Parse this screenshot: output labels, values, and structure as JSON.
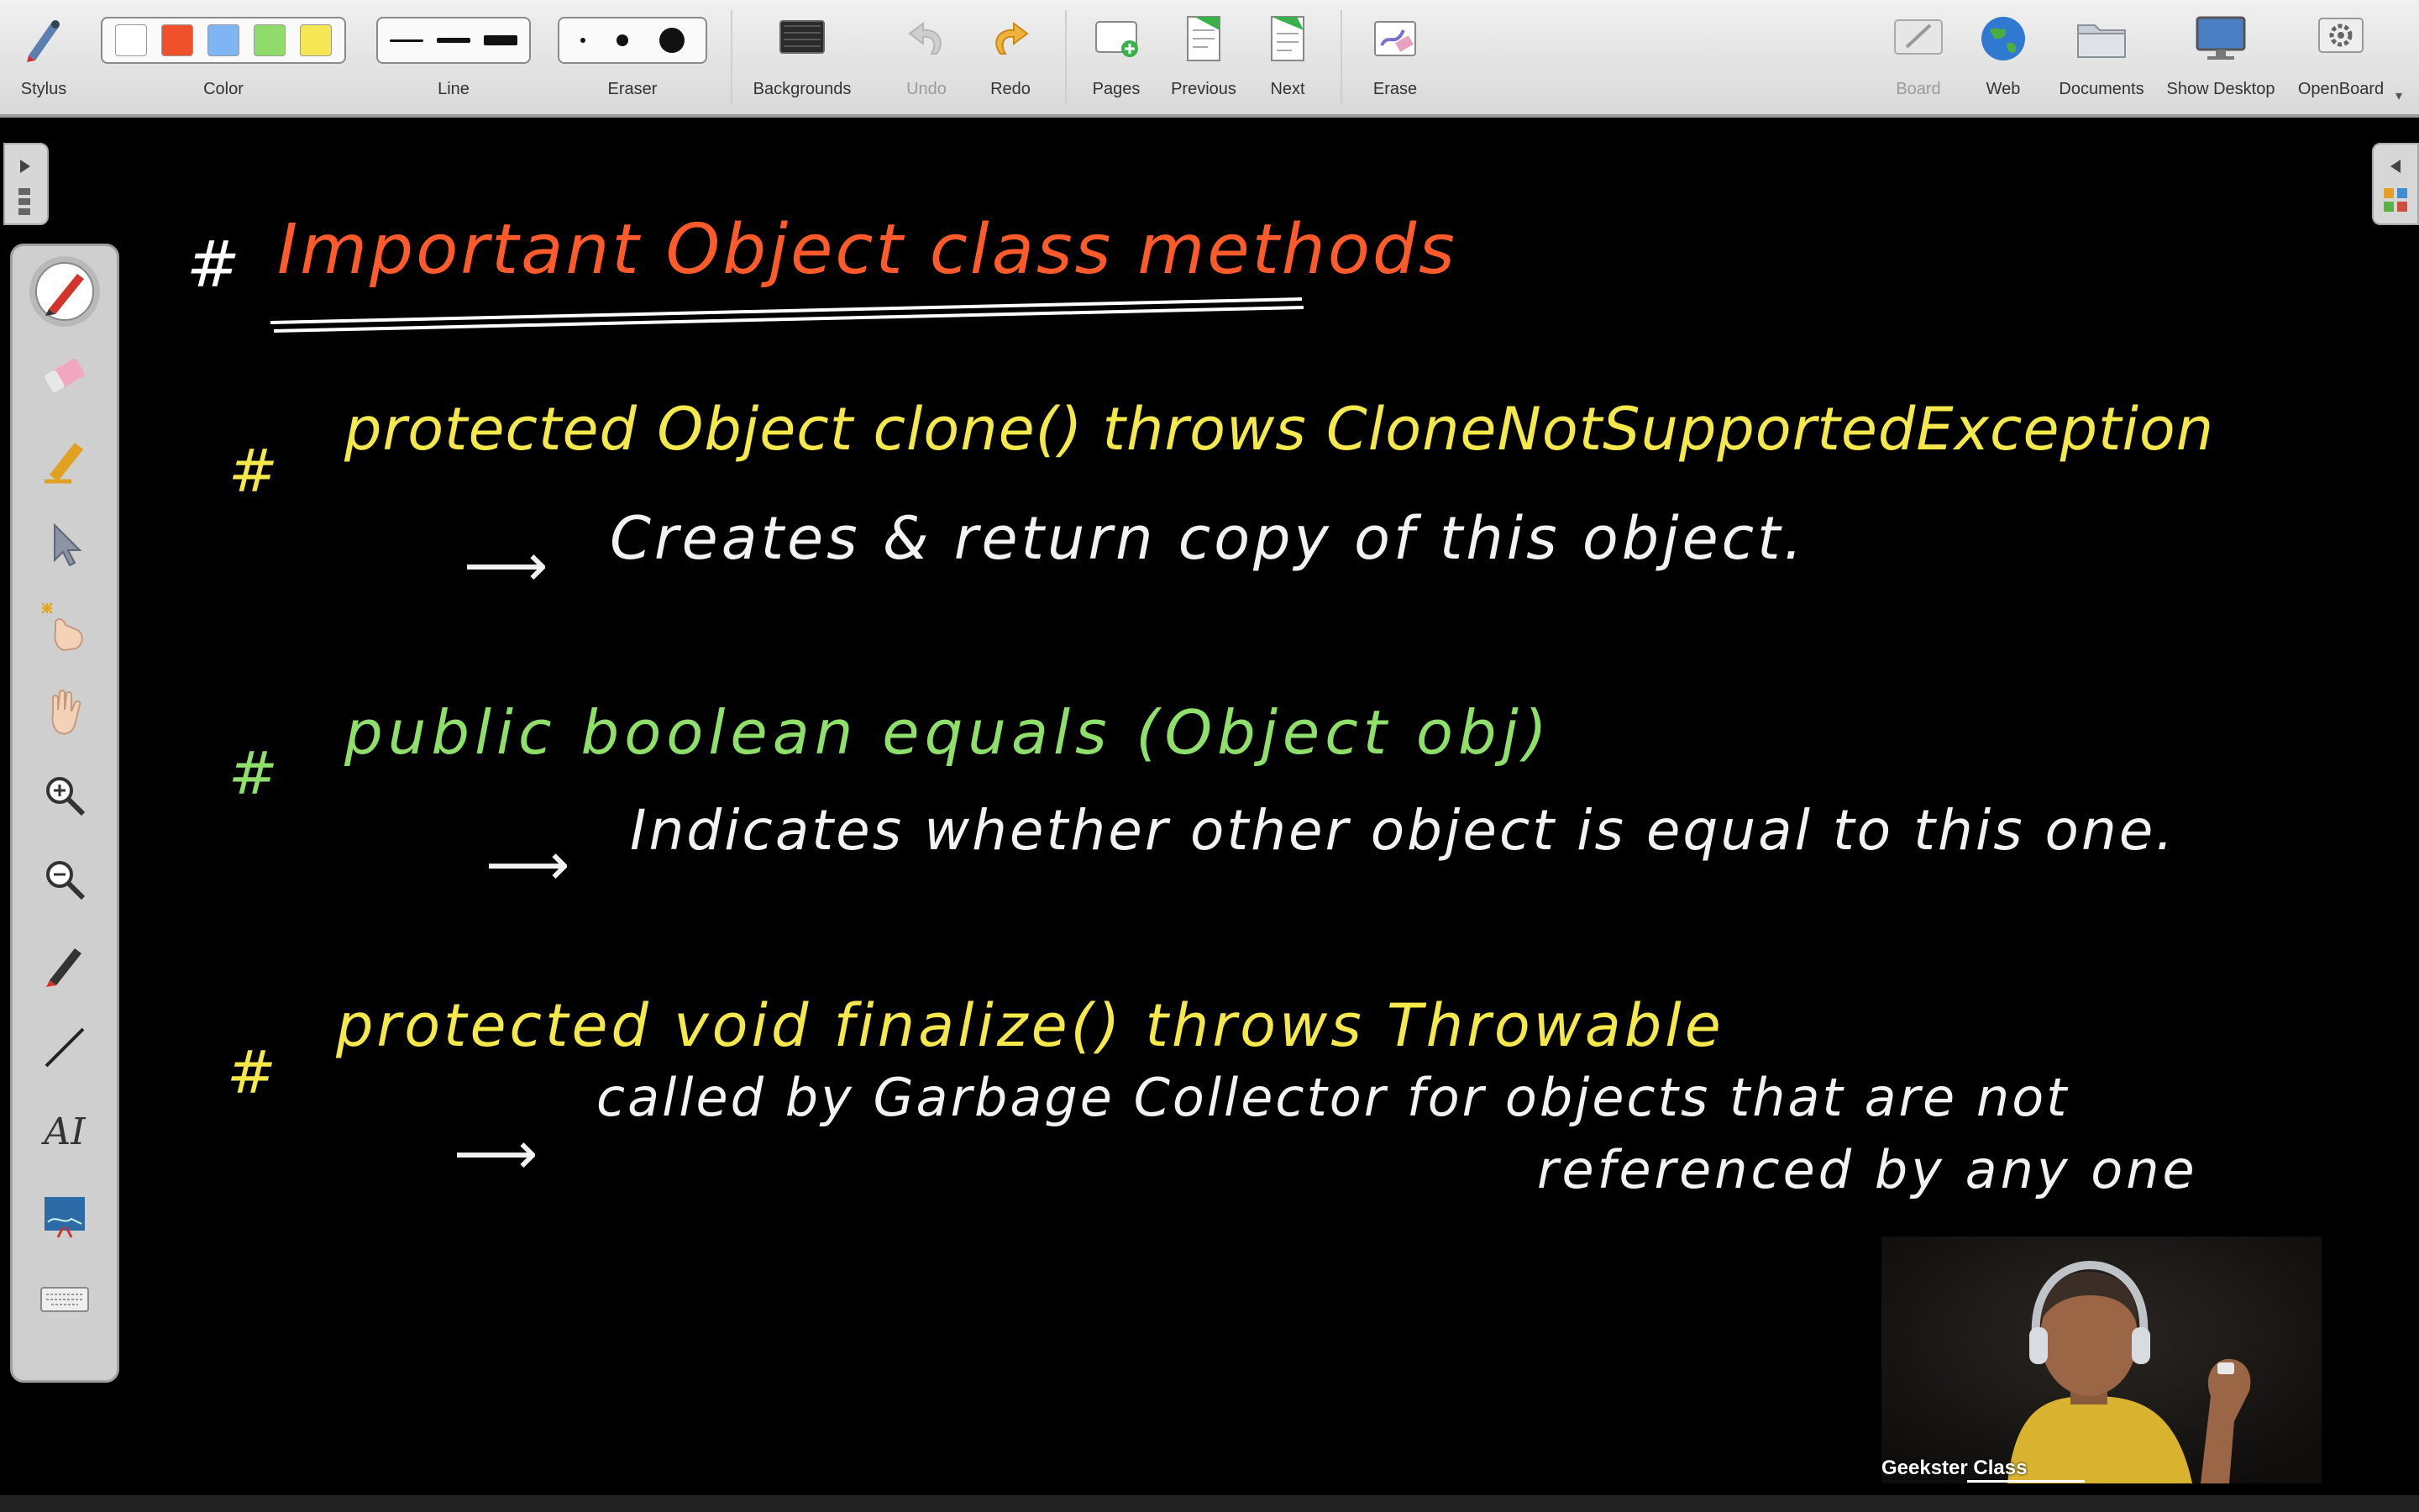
{
  "toolbar": {
    "stylus_label": "Stylus",
    "color_label": "Color",
    "colors": [
      "#ffffff",
      "#f0512a",
      "#7fb5f5",
      "#8fdc6a",
      "#f5e653"
    ],
    "line_label": "Line",
    "eraser_label": "Eraser",
    "backgrounds_label": "Backgrounds",
    "undo_label": "Undo",
    "redo_label": "Redo",
    "pages_label": "Pages",
    "previous_label": "Previous",
    "next_label": "Next",
    "erase_label": "Erase",
    "board_label": "Board",
    "web_label": "Web",
    "documents_label": "Documents",
    "show_desktop_label": "Show Desktop",
    "openboard_label": "OpenBoard"
  },
  "palette": {
    "tools": [
      "pen-icon",
      "eraser-icon",
      "highlighter-icon",
      "pointer-icon",
      "laser-pointer-icon",
      "hand-icon",
      "zoom-in-icon",
      "zoom-out-icon",
      "marker-icon",
      "line-icon",
      "text-icon",
      "capture-icon",
      "keyboard-icon"
    ],
    "text_tool_glyph": "AI"
  },
  "board": {
    "heading_hash": "#",
    "heading": "Important Object class methods",
    "method1": {
      "hash": "#",
      "signature": "protected Object clone() throws CloneNotSupportedException",
      "arrow": "⟶",
      "note": "Creates & return copy of this object."
    },
    "method2": {
      "hash": "#",
      "signature": "public boolean equals (Object obj)",
      "arrow": "⟶",
      "note": "Indicates whether other object is equal to this one."
    },
    "method3": {
      "hash": "#",
      "signature": "protected void finalize() throws Throwable",
      "arrow": "⟶",
      "note_line1": "called by Garbage Collector for objects that are not",
      "note_line2": "referenced by any one"
    },
    "colors": {
      "heading": "#ff5a2a",
      "yellow": "#f5e84a",
      "green": "#8ee06a",
      "white": "#f2f2f2"
    }
  },
  "webcam": {
    "name": "Geekster Class"
  }
}
